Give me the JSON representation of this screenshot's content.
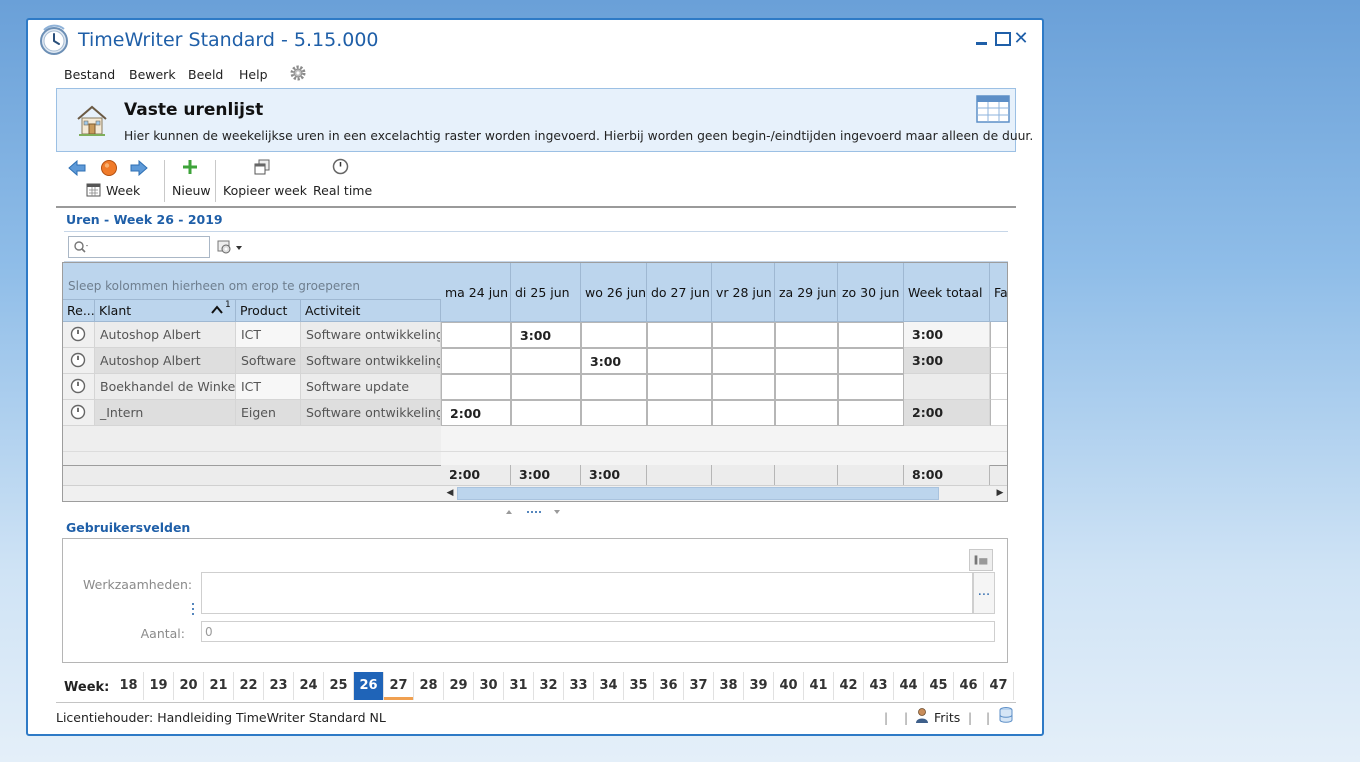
{
  "window": {
    "title": "TimeWriter Standard - 5.15.000"
  },
  "menu": [
    "Bestand",
    "Bewerk",
    "Beeld",
    "Help"
  ],
  "banner": {
    "title": "Vaste urenlijst",
    "description": "Hier kunnen de weekelijkse uren in een excelachtig raster worden ingevoerd. Hierbij worden geen begin-/eindtijden ingevoerd maar alleen de duur."
  },
  "toolbar": {
    "week_label": "Week",
    "new_label": "Nieuw",
    "copy_week_label": "Kopieer week",
    "real_time_label": "Real time"
  },
  "hours": {
    "section_title": "Uren - Week  26 - 2019",
    "search_placeholder": ""
  },
  "grid": {
    "group_hint": "Sleep kolommen hierheen om erop te groeperen",
    "columns": {
      "re": "Re...",
      "klant": "Klant",
      "klant_sort_index": "1",
      "product": "Product",
      "activiteit": "Activiteit",
      "days": [
        "ma 24 jun",
        "di 25 jun",
        "wo 26 jun",
        "do 27 jun",
        "vr 28 jun",
        "za 29 jun",
        "zo 30 jun"
      ],
      "week_total": "Week totaal",
      "fa": "Fa"
    },
    "rows": [
      {
        "klant": "Autoshop Albert",
        "product": "ICT",
        "activiteit": "Software ontwikkeling",
        "days": [
          "",
          "3:00",
          "",
          "",
          "",
          "",
          ""
        ],
        "total": "3:00"
      },
      {
        "klant": "Autoshop Albert",
        "product": "Software",
        "activiteit": "Software ontwikkeling",
        "days": [
          "",
          "",
          "3:00",
          "",
          "",
          "",
          ""
        ],
        "total": "3:00"
      },
      {
        "klant": "Boekhandel de Winkel",
        "product": "ICT",
        "activiteit": "Software update",
        "days": [
          "",
          "",
          "",
          "",
          "",
          "",
          ""
        ],
        "total": ""
      },
      {
        "klant": "_Intern",
        "product": "Eigen",
        "activiteit": "Software ontwikkeling",
        "days": [
          "2:00",
          "",
          "",
          "",
          "",
          "",
          ""
        ],
        "total": "2:00"
      }
    ],
    "totals": [
      "2:00",
      "3:00",
      "3:00",
      "",
      "",
      "",
      ""
    ],
    "grand_total": "8:00"
  },
  "user_fields": {
    "title": "Gebruikersvelden",
    "werkzaamheden_label": "Werkzaamheden:",
    "werkzaamheden_value": "",
    "more_label": "...",
    "aantal_label": "Aantal:",
    "aantal_value": "0"
  },
  "week_bar": {
    "label": "Week:",
    "weeks": [
      "18",
      "19",
      "20",
      "21",
      "22",
      "23",
      "24",
      "25",
      "26",
      "27",
      "28",
      "29",
      "30",
      "31",
      "32",
      "33",
      "34",
      "35",
      "36",
      "37",
      "38",
      "39",
      "40",
      "41",
      "42",
      "43",
      "44",
      "45",
      "46",
      "47"
    ],
    "selected": "26",
    "current": "27"
  },
  "status": {
    "license": "Licentiehouder: Handleiding TimeWriter Standard NL",
    "user": "Frits"
  },
  "colors": {
    "accent": "#1f5fa8",
    "header_bg": "#bcd5ed",
    "selected_week": "#1f64b8",
    "current_week_marker": "#f0a050"
  }
}
